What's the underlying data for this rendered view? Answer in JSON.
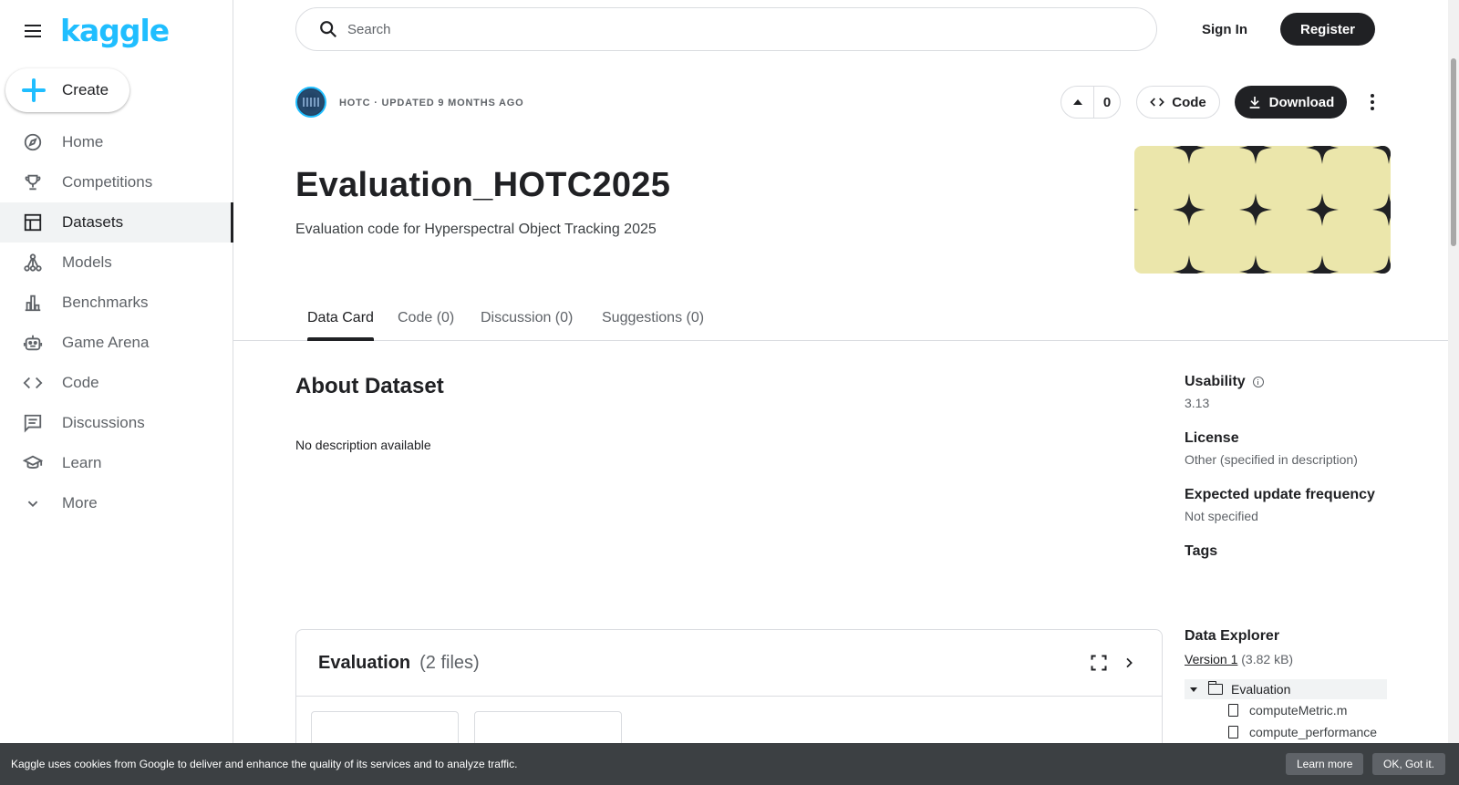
{
  "brand": {
    "logo_text": "kaggle",
    "accent": "#20beff"
  },
  "sidebar": {
    "create_label": "Create",
    "items": [
      {
        "label": "Home",
        "icon": "compass-icon"
      },
      {
        "label": "Competitions",
        "icon": "trophy-icon"
      },
      {
        "label": "Datasets",
        "icon": "table-icon",
        "active": true
      },
      {
        "label": "Models",
        "icon": "models-icon"
      },
      {
        "label": "Benchmarks",
        "icon": "bar-chart-icon"
      },
      {
        "label": "Game Arena",
        "icon": "robot-icon"
      },
      {
        "label": "Code",
        "icon": "code-icon"
      },
      {
        "label": "Discussions",
        "icon": "comments-icon"
      },
      {
        "label": "Learn",
        "icon": "graduation-cap-icon"
      },
      {
        "label": "More",
        "icon": "chevron-down-icon"
      }
    ]
  },
  "header": {
    "search_placeholder": "Search",
    "sign_in": "Sign In",
    "register": "Register"
  },
  "dataset": {
    "meta": "HOTC · UPDATED 9 MONTHS AGO",
    "upvotes": "0",
    "code_label": "Code",
    "download_label": "Download",
    "title": "Evaluation_HOTC2025",
    "subtitle": "Evaluation code for Hyperspectral Object Tracking 2025",
    "banner_color": "#ebe6ab"
  },
  "tabs": [
    {
      "label": "Data Card",
      "active": true
    },
    {
      "label": "Code (0)"
    },
    {
      "label": "Discussion (0)"
    },
    {
      "label": "Suggestions (0)"
    }
  ],
  "about": {
    "heading": "About Dataset",
    "text": "No description available"
  },
  "details": {
    "usability_label": "Usability",
    "usability_value": "3.13",
    "license_label": "License",
    "license_value": "Other (specified in description)",
    "frequency_label": "Expected update frequency",
    "frequency_value": "Not specified",
    "tags_label": "Tags"
  },
  "explorer": {
    "heading": "Data Explorer",
    "version_link": "Version 1",
    "version_size": "(3.82 kB)",
    "folder": "Evaluation",
    "files": [
      "computeMetric.m",
      "compute_performance"
    ]
  },
  "files_card": {
    "name": "Evaluation",
    "count": "(2 files)"
  },
  "cookie": {
    "message": "Kaggle uses cookies from Google to deliver and enhance the quality of its services and to analyze traffic.",
    "learn_more": "Learn more",
    "ok": "OK, Got it."
  }
}
